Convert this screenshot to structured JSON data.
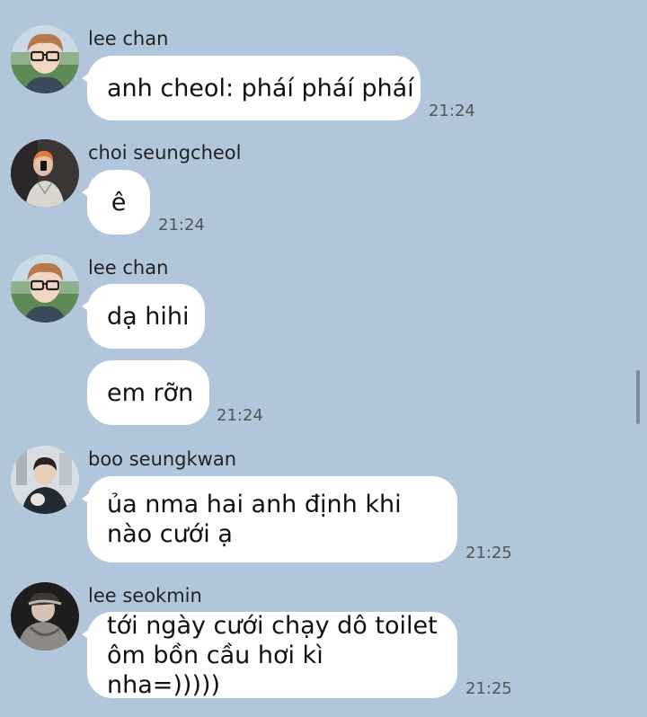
{
  "messages": [
    {
      "sender": "lee chan",
      "avatar_icon": "avatar-lee-chan-icon",
      "bubbles": [
        "anh cheol: pháí pháí pháí"
      ],
      "time": "21:24"
    },
    {
      "sender": "choi seungcheol",
      "avatar_icon": "avatar-choi-seungcheol-icon",
      "bubbles": [
        "ê"
      ],
      "time": "21:24"
    },
    {
      "sender": "lee chan",
      "avatar_icon": "avatar-lee-chan-icon",
      "bubbles": [
        "dạ hihi",
        "em rỡn"
      ],
      "time": "21:24"
    },
    {
      "sender": "boo seungkwan",
      "avatar_icon": "avatar-boo-seungkwan-icon",
      "bubbles": [
        "ủa nma hai anh định khi\nnào cưới ạ"
      ],
      "time": "21:25"
    },
    {
      "sender": "lee seokmin",
      "avatar_icon": "avatar-lee-seokmin-icon",
      "bubbles": [
        "tới ngày cưới chạy dô toilet\nôm bồn cầu hơi kì nha=)))))"
      ],
      "time": "21:25"
    }
  ],
  "colors": {
    "background": "#b1c6db",
    "bubble": "#ffffff",
    "time_text": "#555555"
  }
}
